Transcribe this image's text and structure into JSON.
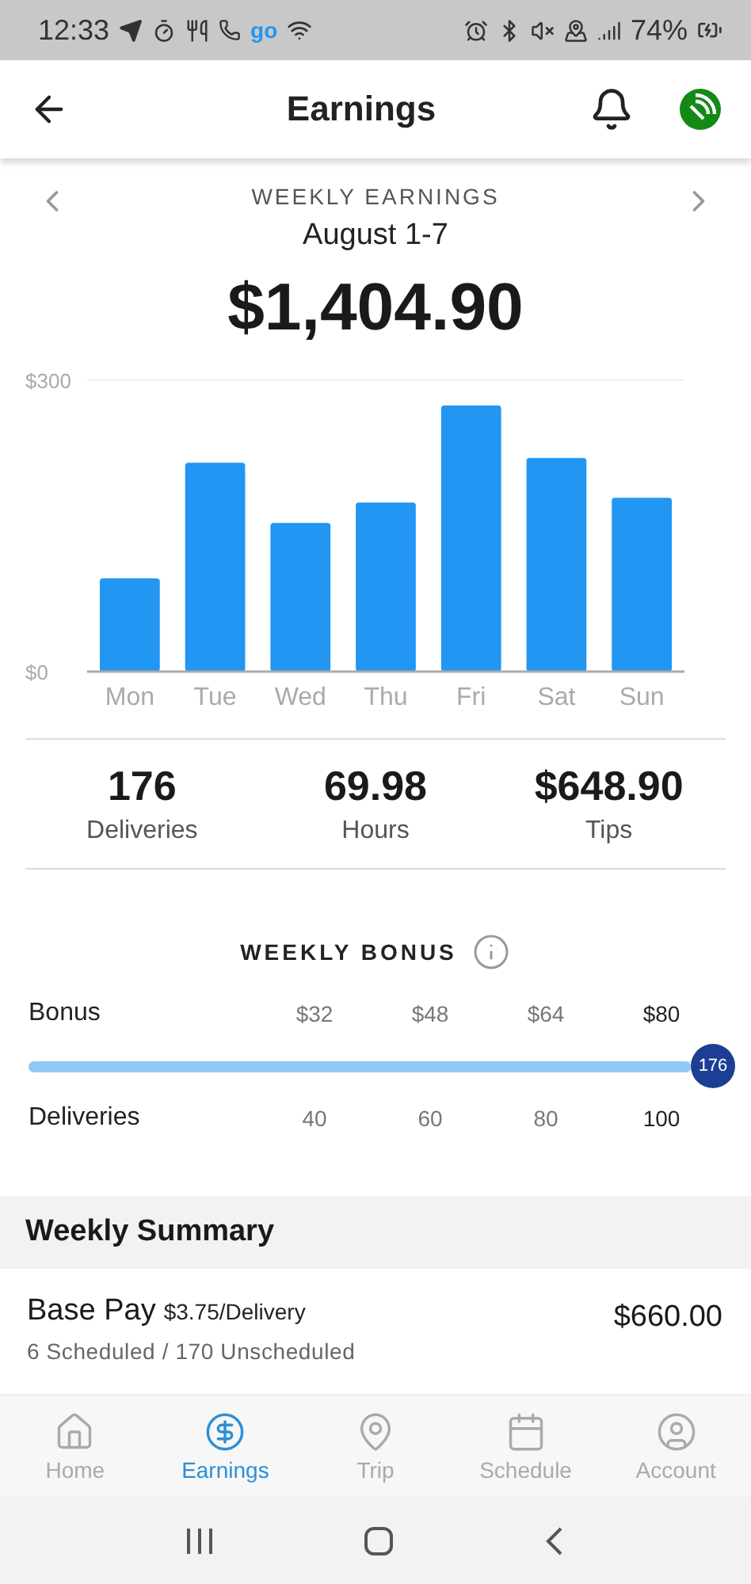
{
  "status_bar": {
    "time": "12:33",
    "app_label": "go",
    "battery": "74%"
  },
  "header": {
    "title": "Earnings"
  },
  "period": {
    "heading": "WEEKLY EARNINGS",
    "range": "August 1-7",
    "total": "$1,404.90"
  },
  "chart_data": {
    "type": "bar",
    "categories": [
      "Mon",
      "Tue",
      "Wed",
      "Thu",
      "Fri",
      "Sat",
      "Sun"
    ],
    "series": [
      {
        "color": "#2196f3",
        "values": [
          96,
          215,
          153,
          174,
          274,
          220,
          179
        ]
      }
    ],
    "ylim": [
      0,
      300
    ],
    "yticks": [
      {
        "value": 0,
        "label": "$0"
      },
      {
        "value": 300,
        "label": "$300"
      }
    ]
  },
  "stats": [
    {
      "value": "176",
      "label": "Deliveries"
    },
    {
      "value": "69.98",
      "label": "Hours"
    },
    {
      "value": "$648.90",
      "label": "Tips"
    }
  ],
  "weekly_bonus": {
    "title": "WEEKLY BONUS",
    "bonus_label": "Bonus",
    "deliveries_label": "Deliveries",
    "tiers": [
      {
        "bonus": "$32",
        "deliveries": "40",
        "reached": false
      },
      {
        "bonus": "$48",
        "deliveries": "60",
        "reached": false
      },
      {
        "bonus": "$64",
        "deliveries": "80",
        "reached": false
      },
      {
        "bonus": "$80",
        "deliveries": "100",
        "reached": true
      }
    ],
    "level": 1,
    "count": "176"
  },
  "summary": {
    "title": "Weekly Summary",
    "rows": [
      {
        "label": "Base Pay",
        "rate": "$3.75/Delivery",
        "detail": "6 Scheduled / 170 Unscheduled",
        "amount": "$660.00"
      }
    ]
  },
  "bottom_nav": [
    {
      "label": "Home",
      "selected": false
    },
    {
      "label": "Earnings",
      "selected": true
    },
    {
      "label": "Trip",
      "selected": false
    },
    {
      "label": "Schedule",
      "selected": false
    },
    {
      "label": "Account",
      "selected": false
    }
  ]
}
